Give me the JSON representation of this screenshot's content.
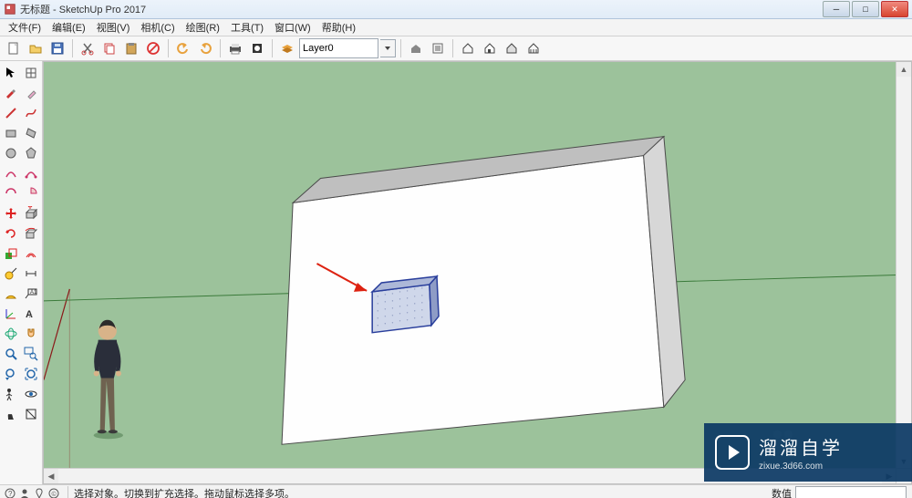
{
  "title": "无标题 - SketchUp Pro 2017",
  "menu": {
    "file": "文件(F)",
    "edit": "编辑(E)",
    "view": "视图(V)",
    "camera": "相机(C)",
    "draw": "绘图(R)",
    "tools": "工具(T)",
    "window": "窗口(W)",
    "help": "帮助(H)"
  },
  "toolbar": {
    "layer_value": "Layer0"
  },
  "status": {
    "hint": "选择对象。切换到扩充选择。拖动鼠标选择多项。",
    "measure_label": "数值"
  },
  "watermark": {
    "line1": "溜溜自学",
    "line2": "zixue.3d66.com"
  },
  "icons": {
    "app": "⬛",
    "min": "▁",
    "max": "▢",
    "close": "✕"
  }
}
